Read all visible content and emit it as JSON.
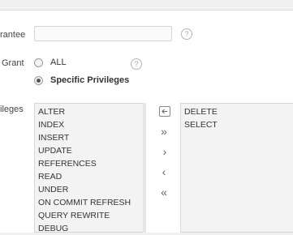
{
  "form": {
    "grantee_label": "rantee",
    "grant_label": "Grant",
    "privileges_label": "ileges",
    "grantee_value": "",
    "help_glyph": "?",
    "grant_options": [
      {
        "label": "ALL",
        "checked": false
      },
      {
        "label": "Specific Privileges",
        "checked": true
      }
    ]
  },
  "shuttle": {
    "available": [
      "ALTER",
      "INDEX",
      "INSERT",
      "UPDATE",
      "REFERENCES",
      "READ",
      "UNDER",
      "ON COMMIT REFRESH",
      "QUERY REWRITE",
      "DEBUG"
    ],
    "selected": [
      "DELETE",
      "SELECT"
    ],
    "buttons": {
      "reset": "reset-icon",
      "move_all": "»",
      "move": "›",
      "remove": "‹",
      "remove_all": "«"
    }
  }
}
